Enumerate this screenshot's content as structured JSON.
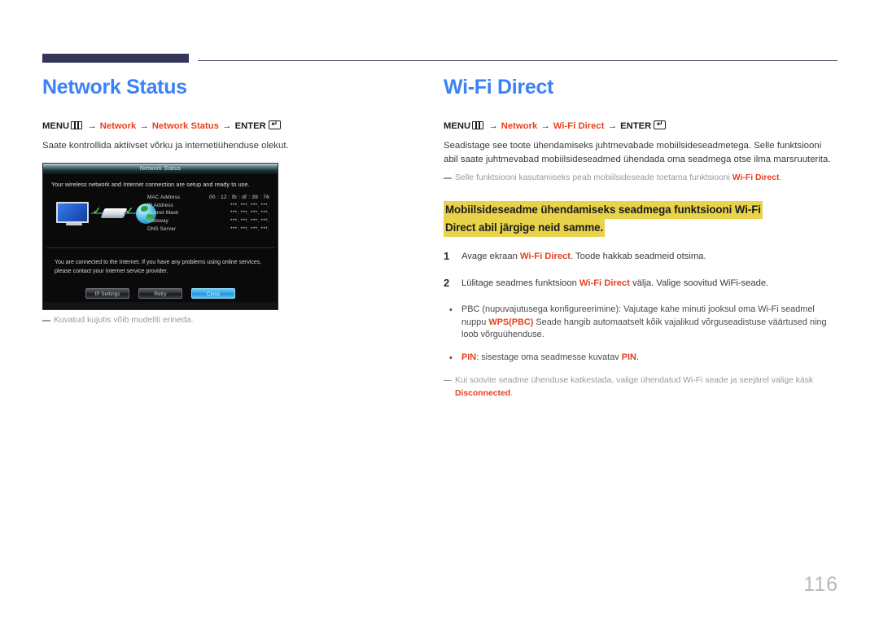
{
  "page": {
    "number": "116"
  },
  "left_column": {
    "title": "Network Status",
    "menu_path": {
      "menu_label": "MENU",
      "menu_icon": "menu-grid-icon",
      "arrow": "→",
      "item1": "Network",
      "item2": "Network Status",
      "enter_label": "ENTER",
      "enter_icon": "enter-key-icon"
    },
    "description": "Saate kontrollida aktiivset võrku ja internetiühenduse olekut.",
    "caption_note": "Kuvatud kujutis võib mudeliti erineda.",
    "tv_screenshot": {
      "window_title": "Network Status",
      "lead_text": "Your wireless network and Internet connection are setup and ready to use.",
      "details_rows": [
        {
          "label": "MAC Address",
          "value": "00 : 12 : fb : df : 39 : 76"
        },
        {
          "label": "IP Address",
          "value": "***.   ***.   ***.   ***."
        },
        {
          "label": "Subnet Mask",
          "value": "***.   ***.   ***.   ***."
        },
        {
          "label": "Gateway",
          "value": "***.   ***.   ***.   ***."
        },
        {
          "label": "DNS Server",
          "value": "***.   ***.   ***.   ***."
        }
      ],
      "status_message": "You are connected to the Internet. If you have any problems using online services, please contact your Internet service provider.",
      "buttons": [
        {
          "label": "IP Settings",
          "primary": false
        },
        {
          "label": "Retry",
          "primary": false
        },
        {
          "label": "Close",
          "primary": true
        }
      ]
    }
  },
  "right_column": {
    "title": "Wi-Fi Direct",
    "menu_path": {
      "menu_label": "MENU",
      "menu_icon": "menu-grid-icon",
      "arrow": "→",
      "item1": "Network",
      "item2": "Wi-Fi Direct",
      "enter_label": "ENTER",
      "enter_icon": "enter-key-icon"
    },
    "description": "Seadistage see toote ühendamiseks juhtmevabade mobiilsideseadmetega. Selle funktsiooni abil saate juhtmevabad mobiilsideseadmed ühendada oma seadmega otse ilma marsruuterita.",
    "note_1": {
      "text_before": "Selle funktsiooni kasutamiseks peab mobiilsideseade toetama funktsiooni ",
      "accent": "Wi-Fi Direct",
      "text_after": "."
    },
    "highlight_heading": {
      "line1": "Mobiilsideseadme ühendamiseks seadmega funktsiooni Wi-Fi",
      "line2": "Direct abil järgige neid samme."
    },
    "steps": [
      {
        "number": "1",
        "text_before": "Avage ekraan ",
        "accent": "Wi-Fi Direct",
        "text_after": ". Toode hakkab seadmeid otsima."
      },
      {
        "number": "2",
        "text_before": "Lülitage seadmes funktsioon ",
        "accent": "Wi-Fi Direct",
        "text_after": " välja. Valige soovitud WiFi-seade."
      }
    ],
    "bullets": [
      {
        "marker": "•",
        "text_before": "PBC (nupuvajutusega konfigureerimine): Vajutage kahe minuti jooksul oma Wi-Fi seadmel nuppu ",
        "accent": "WPS(PBC)",
        "text_after": " Seade hangib automaatselt kõik vajalikud võrguseadistuse väärtused ning loob võrguühenduse."
      },
      {
        "marker": "•",
        "text_before": "",
        "accent": "PIN",
        "text_mid": ": sisestage oma seadmesse kuvatav ",
        "accent2": "PIN",
        "text_after": "."
      }
    ],
    "note_2": {
      "text_before": "Kui soovite seadme ühenduse katkestada, valige ühendatud Wi-Fi seade ja seejärel valige käsk ",
      "accent": "Disconnected",
      "text_after": "."
    }
  },
  "colors": {
    "title_blue": "#3b82f6",
    "accent_orange": "#e8401f",
    "rule_navy": "#353559",
    "highlight_yellow": "#e8d34a",
    "page_num_gray": "#b9b9b9"
  }
}
